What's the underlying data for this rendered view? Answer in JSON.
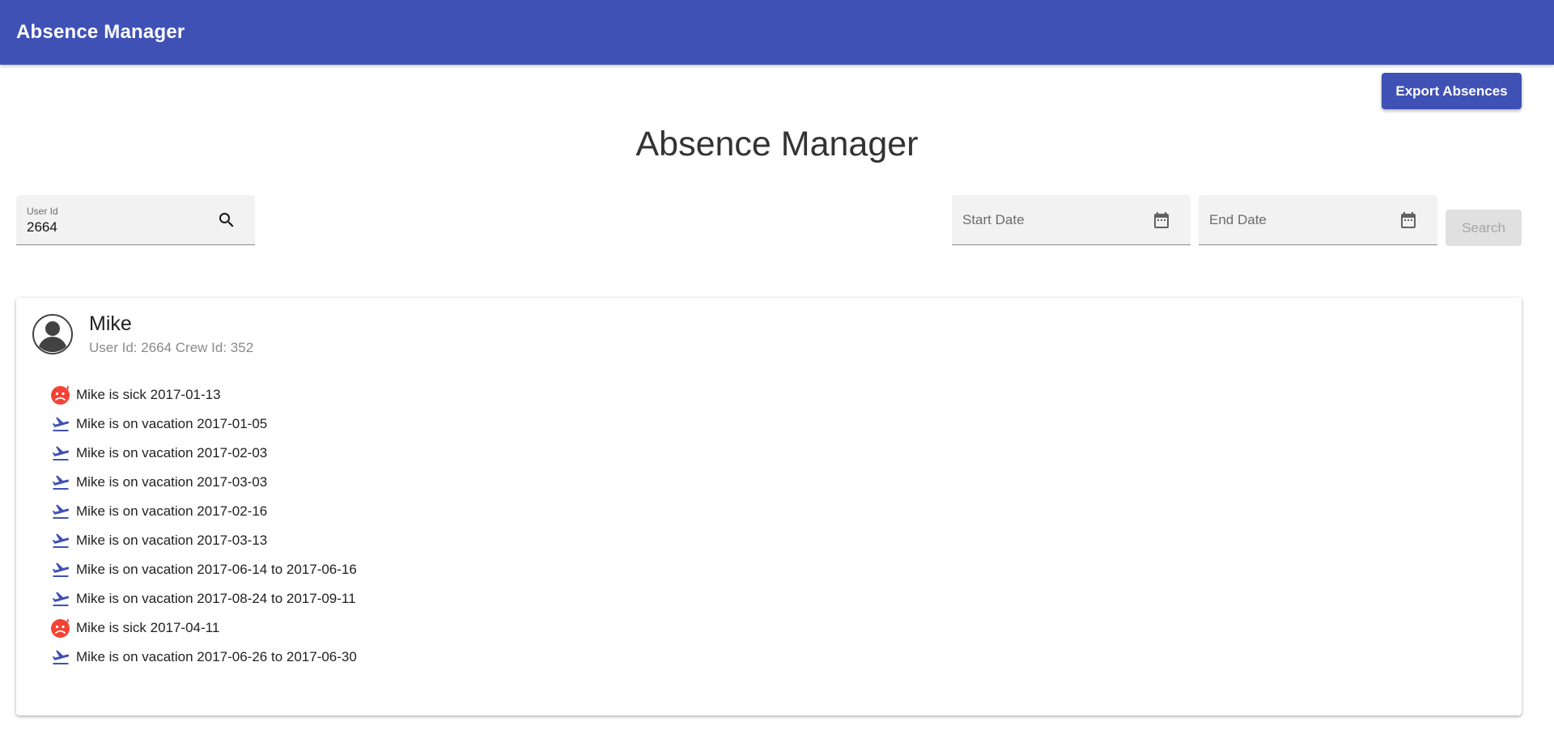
{
  "appbar": {
    "title": "Absence Manager"
  },
  "toolbar": {
    "export_label": "Export Absences"
  },
  "page": {
    "title": "Absence Manager"
  },
  "filters": {
    "user_id": {
      "label": "User Id",
      "value": "2664",
      "icon": "search-icon"
    },
    "start_date": {
      "placeholder": "Start Date",
      "icon": "calendar-icon"
    },
    "end_date": {
      "placeholder": "End Date",
      "icon": "calendar-icon"
    },
    "search_label": "Search"
  },
  "user": {
    "name": "Mike",
    "subtitle": "User Id: 2664 Crew Id: 352",
    "avatar_icon": "account-circle-icon"
  },
  "absences": [
    {
      "type": "sick",
      "icon": "sick-face-icon",
      "text": "Mike is sick 2017-01-13"
    },
    {
      "type": "vacation",
      "icon": "flight-takeoff-icon",
      "text": "Mike is on vacation 2017-01-05"
    },
    {
      "type": "vacation",
      "icon": "flight-takeoff-icon",
      "text": "Mike is on vacation 2017-02-03"
    },
    {
      "type": "vacation",
      "icon": "flight-takeoff-icon",
      "text": "Mike is on vacation 2017-03-03"
    },
    {
      "type": "vacation",
      "icon": "flight-takeoff-icon",
      "text": "Mike is on vacation 2017-02-16"
    },
    {
      "type": "vacation",
      "icon": "flight-takeoff-icon",
      "text": "Mike is on vacation 2017-03-13"
    },
    {
      "type": "vacation",
      "icon": "flight-takeoff-icon",
      "text": "Mike is on vacation 2017-06-14 to 2017-06-16"
    },
    {
      "type": "vacation",
      "icon": "flight-takeoff-icon",
      "text": "Mike is on vacation 2017-08-24 to 2017-09-11"
    },
    {
      "type": "sick",
      "icon": "sick-face-icon",
      "text": "Mike is sick 2017-04-11"
    },
    {
      "type": "vacation",
      "icon": "flight-takeoff-icon",
      "text": "Mike is on vacation 2017-06-26 to 2017-06-30"
    }
  ],
  "colors": {
    "primary": "#3f51b5",
    "sick": "#f44336",
    "vacation": "#3f51b5",
    "disabled_button": "#e0e0e0"
  }
}
